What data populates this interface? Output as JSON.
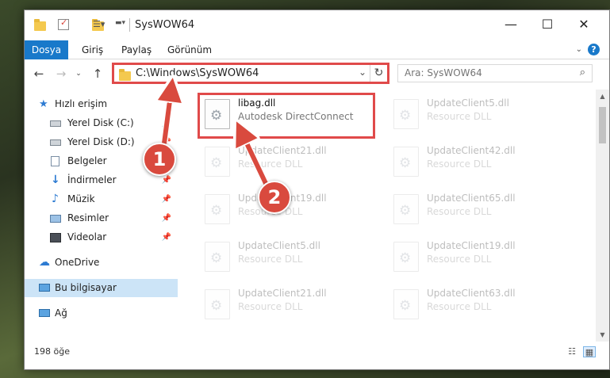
{
  "window": {
    "title": "SysWOW64",
    "controls": {
      "minimize": "—",
      "maximize": "☐",
      "close": "✕"
    }
  },
  "ribbon": {
    "tabs": [
      "Dosya",
      "Giriş",
      "Paylaş",
      "Görünüm"
    ],
    "help": "?"
  },
  "nav": {
    "path": "C:\\Windows\\SysWOW64",
    "search_placeholder": "Ara: SysWOW64"
  },
  "sidebar": {
    "items": [
      {
        "label": "Hızlı erişim",
        "icon": "star-icon"
      },
      {
        "label": "Yerel Disk (C:)",
        "icon": "drive-icon",
        "pinned": true
      },
      {
        "label": "Yerel Disk (D:)",
        "icon": "drive-icon",
        "pinned": true
      },
      {
        "label": "Belgeler",
        "icon": "documents-icon",
        "pinned": true
      },
      {
        "label": "İndirmeler",
        "icon": "download-icon",
        "pinned": true
      },
      {
        "label": "Müzik",
        "icon": "music-icon",
        "pinned": true
      },
      {
        "label": "Resimler",
        "icon": "pictures-icon",
        "pinned": true
      },
      {
        "label": "Videolar",
        "icon": "videos-icon",
        "pinned": true
      },
      {
        "label": "OneDrive",
        "icon": "cloud-icon"
      },
      {
        "label": "Bu bilgisayar",
        "icon": "computer-icon",
        "selected": true
      },
      {
        "label": "Ağ",
        "icon": "network-icon"
      }
    ]
  },
  "files": [
    {
      "name": "libag.dll",
      "type": "Autodesk DirectConnect",
      "highlighted": true
    },
    {
      "name": "UpdateClient5.dll",
      "type": "Resource DLL"
    },
    {
      "name": "UpdateClient21.dll",
      "type": "Resource DLL"
    },
    {
      "name": "UpdateClient42.dll",
      "type": "Resource DLL"
    },
    {
      "name": "UpdateClient19.dll",
      "type": "Resource DLL"
    },
    {
      "name": "UpdateClient65.dll",
      "type": "Resource DLL"
    },
    {
      "name": "UpdateClient5.dll",
      "type": "Resource DLL"
    },
    {
      "name": "UpdateClient19.dll",
      "type": "Resource DLL"
    },
    {
      "name": "UpdateClient21.dll",
      "type": "Resource DLL"
    },
    {
      "name": "UpdateClient63.dll",
      "type": "Resource DLL"
    }
  ],
  "status": {
    "count": "198 öğe"
  },
  "annotations": {
    "badge1": "1",
    "badge2": "2",
    "color": "#d94a3e"
  }
}
